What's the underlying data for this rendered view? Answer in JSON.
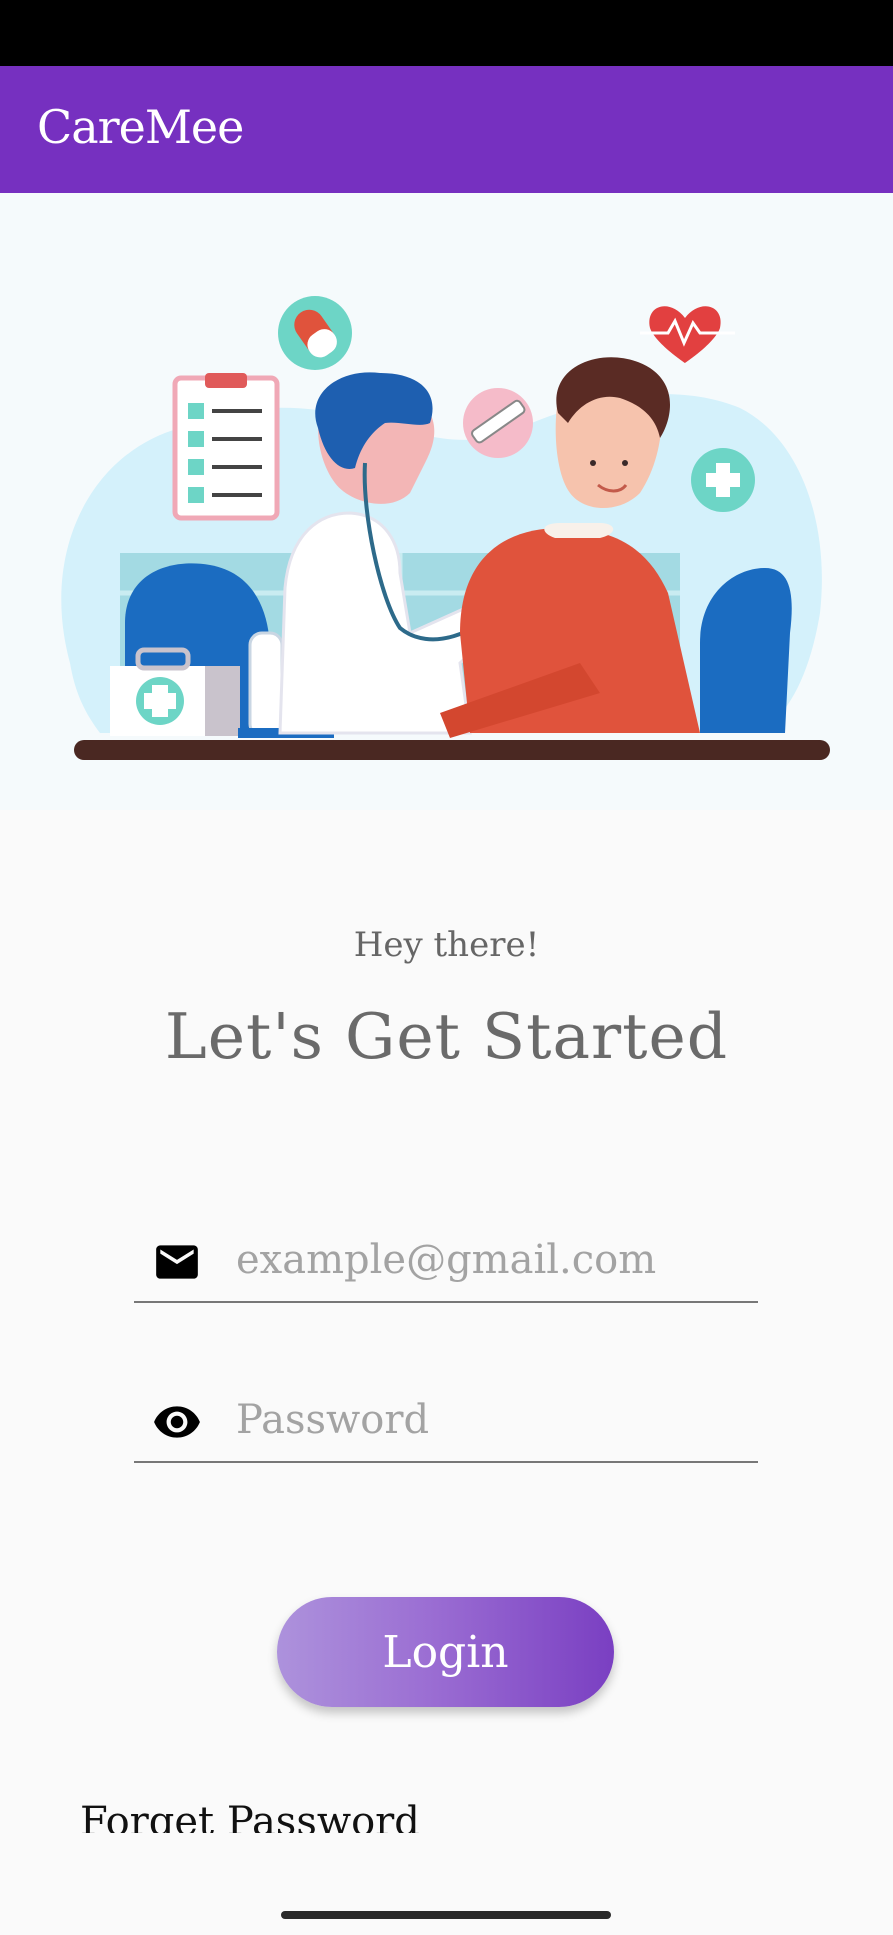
{
  "app_bar": {
    "title": "CareMee",
    "color": "#7630c0"
  },
  "hero": {
    "image": "doctor-patient-illustration"
  },
  "greeting": "Hey there!",
  "headline": "Let's Get Started",
  "email_field": {
    "icon": "mail-icon",
    "placeholder": "example@gmail.com",
    "value": ""
  },
  "password_field": {
    "icon": "eye-icon",
    "placeholder": "Password",
    "value": ""
  },
  "login_button": {
    "label": "Login"
  },
  "forget_password": {
    "label": "Forget Password"
  }
}
